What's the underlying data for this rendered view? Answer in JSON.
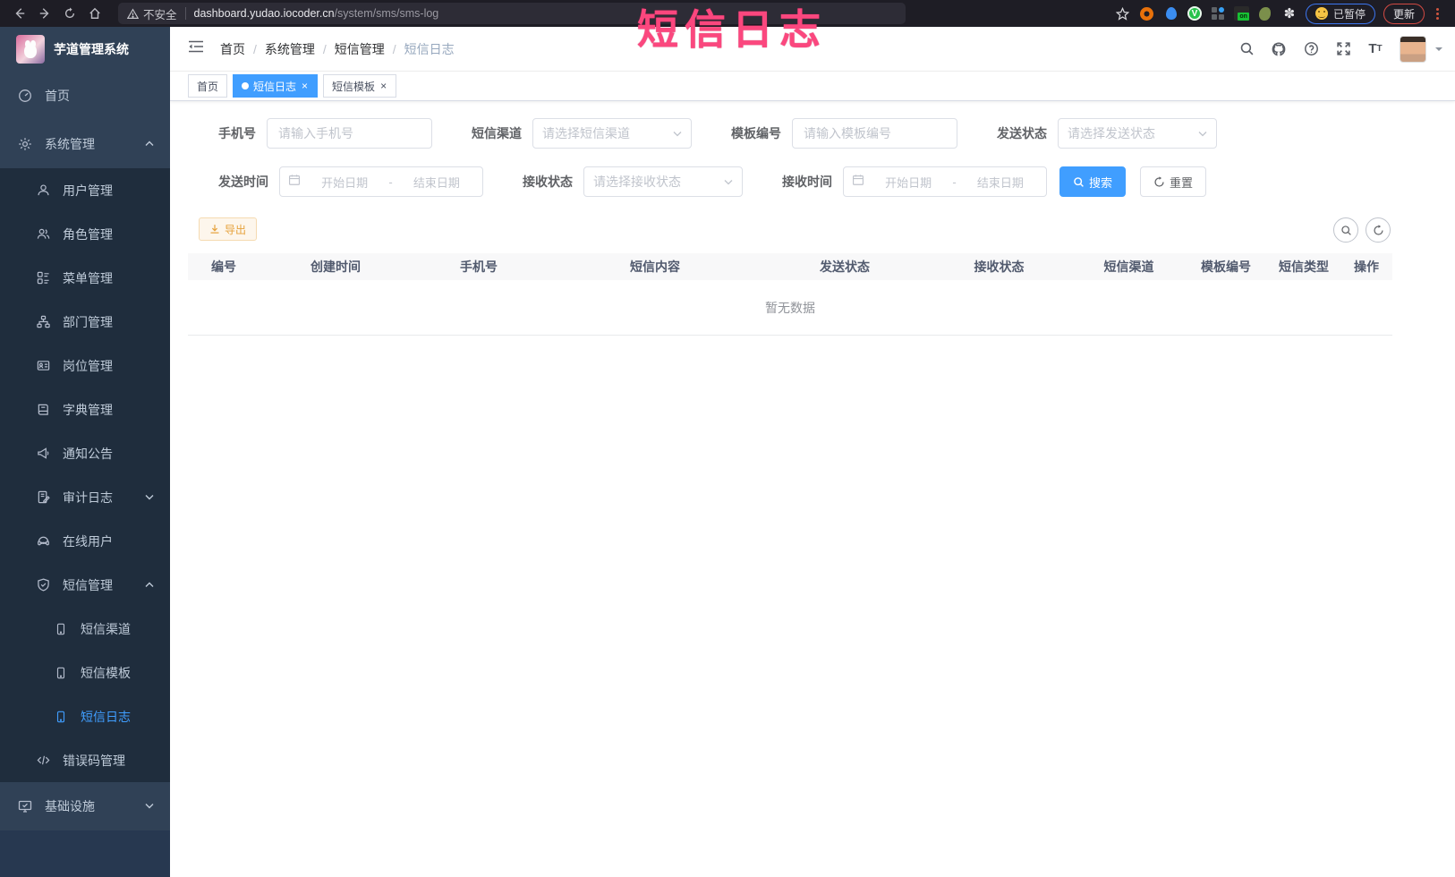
{
  "colors": {
    "accent": "#409eff",
    "overlay_pink": "#fb477e",
    "warning_text": "#e6a23c",
    "sidebar_bg": "#304156",
    "submenu_bg": "#1f2d3d"
  },
  "overlay_title": "短信日志",
  "browser": {
    "security_label": "不安全",
    "url_host": "dashboard.yudao.iocoder.cn",
    "url_path": "/system/sms/sms-log",
    "ext_v_label": "V",
    "ext_on_label": "on",
    "paused_label": "已暂停",
    "update_label": "更新"
  },
  "sidebar": {
    "logo_title": "芋道管理系统",
    "items": [
      {
        "label": "首页"
      },
      {
        "label": "系统管理"
      },
      {
        "label": "用户管理"
      },
      {
        "label": "角色管理"
      },
      {
        "label": "菜单管理"
      },
      {
        "label": "部门管理"
      },
      {
        "label": "岗位管理"
      },
      {
        "label": "字典管理"
      },
      {
        "label": "通知公告"
      },
      {
        "label": "审计日志"
      },
      {
        "label": "在线用户"
      },
      {
        "label": "短信管理"
      },
      {
        "label": "短信渠道"
      },
      {
        "label": "短信模板"
      },
      {
        "label": "短信日志"
      },
      {
        "label": "错误码管理"
      },
      {
        "label": "基础设施"
      }
    ]
  },
  "header": {
    "breadcrumb": [
      "首页",
      "系统管理",
      "短信管理",
      "短信日志"
    ]
  },
  "tabs": [
    {
      "label": "首页"
    },
    {
      "label": "短信日志"
    },
    {
      "label": "短信模板"
    }
  ],
  "filters": {
    "phone": {
      "label": "手机号",
      "placeholder": "请输入手机号"
    },
    "channel": {
      "label": "短信渠道",
      "placeholder": "请选择短信渠道"
    },
    "template_id": {
      "label": "模板编号",
      "placeholder": "请输入模板编号"
    },
    "send_status": {
      "label": "发送状态",
      "placeholder": "请选择发送状态"
    },
    "send_time": {
      "label": "发送时间",
      "start": "开始日期",
      "sep": "-",
      "end": "结束日期"
    },
    "receive_status": {
      "label": "接收状态",
      "placeholder": "请选择接收状态"
    },
    "receive_time": {
      "label": "接收时间",
      "start": "开始日期",
      "sep": "-",
      "end": "结束日期"
    }
  },
  "buttons": {
    "search": "搜索",
    "reset": "重置",
    "export": "导出"
  },
  "table": {
    "headers": [
      "编号",
      "创建时间",
      "手机号",
      "短信内容",
      "发送状态",
      "接收状态",
      "短信渠道",
      "模板编号",
      "短信类型",
      "操作"
    ],
    "empty_text": "暂无数据"
  }
}
